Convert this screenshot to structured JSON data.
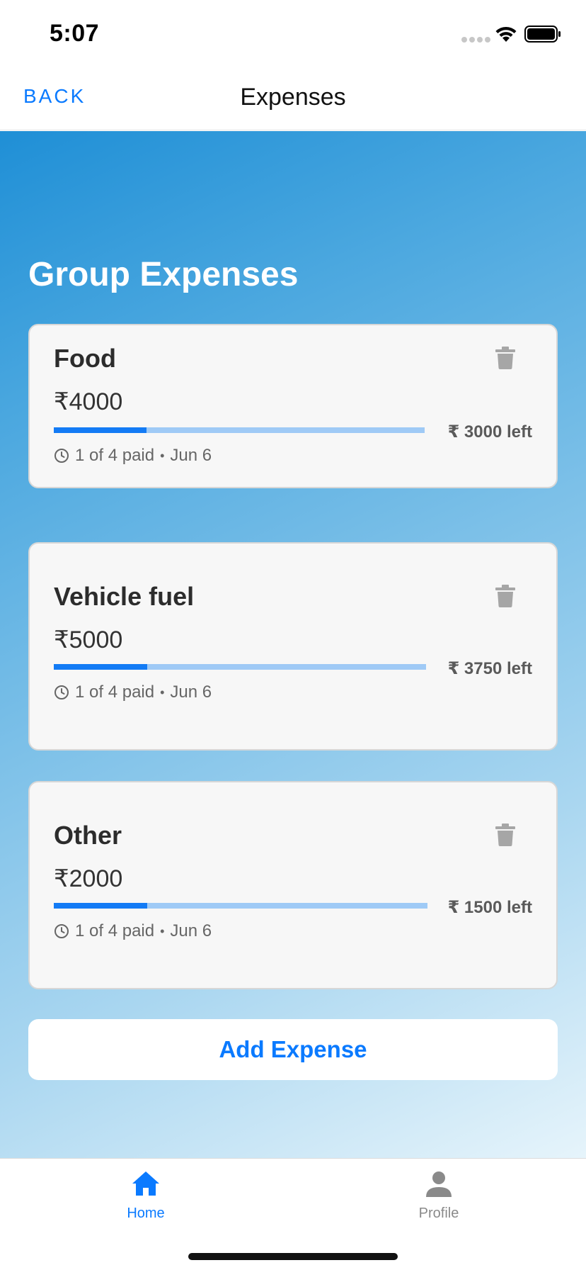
{
  "status_bar": {
    "time": "5:07"
  },
  "nav": {
    "back_label": "BACK",
    "title": "Expenses"
  },
  "main": {
    "section_title": "Group Expenses",
    "expenses": [
      {
        "name": "Food",
        "amount": "₹4000",
        "left_label": "₹ 3000 left",
        "paid_label": "1 of 4 paid",
        "date": "Jun 6",
        "paid_fraction": 0.25
      },
      {
        "name": "Vehicle fuel",
        "amount": "₹5000",
        "left_label": "₹ 3750 left",
        "paid_label": "1 of 4 paid",
        "date": "Jun 6",
        "paid_fraction": 0.25
      },
      {
        "name": "Other",
        "amount": "₹2000",
        "left_label": "₹ 1500 left",
        "paid_label": "1 of 4 paid",
        "date": "Jun 6",
        "paid_fraction": 0.25
      }
    ],
    "add_button_label": "Add Expense"
  },
  "tab_bar": {
    "tabs": [
      {
        "label": "Home",
        "icon": "home-icon",
        "active": true
      },
      {
        "label": "Profile",
        "icon": "person-icon",
        "active": false
      }
    ]
  },
  "colors": {
    "accent": "#0a7aff",
    "progress_fill": "#137bf5",
    "progress_track": "#9fcaf6"
  }
}
